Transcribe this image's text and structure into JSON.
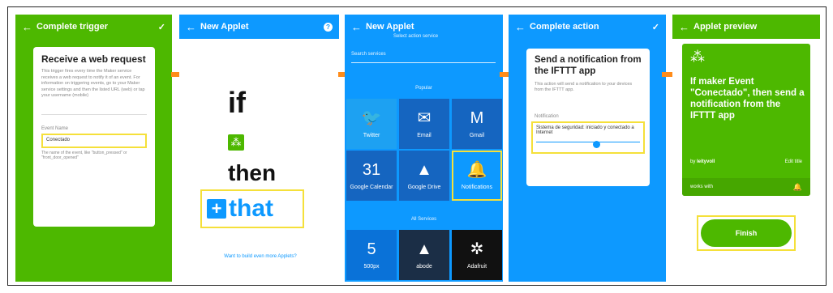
{
  "colors": {
    "green": "#4db800",
    "blue": "#0d99ff",
    "accent_arrow": "#ff8c1a",
    "highlight": "#f5e03a"
  },
  "panel1": {
    "title": "Complete trigger",
    "back_icon": "back-arrow-icon",
    "check_icon": "check-icon",
    "card_title": "Receive a web request",
    "card_desc": "This trigger fires every time the Maker service receives a web request to notify it of an event. For information on triggering events, go to your Maker service settings and then the listed URL (web) or tap your username (mobile)",
    "field_label": "Event Name",
    "field_value": "Conectado",
    "field_hint": "The name of the event, like \"button_pressed\" or \"front_door_opened\""
  },
  "panel2": {
    "title": "New Applet",
    "help_icon": "help-icon",
    "if_text": "if",
    "then_text": "then",
    "that_text": "that",
    "footer_link": "Want to build even more Applets?"
  },
  "panel3": {
    "title": "New Applet",
    "subtitle": "Select action service",
    "search_placeholder": "Search services",
    "section_popular": "Popular",
    "section_all": "All Services",
    "tiles_popular": [
      {
        "label": "Twitter",
        "icon": "twitter-icon",
        "glyph": "🐦",
        "color": "#1da1f2"
      },
      {
        "label": "Email",
        "icon": "email-icon",
        "glyph": "✉",
        "color": "#1565c0"
      },
      {
        "label": "Gmail",
        "icon": "gmail-icon",
        "glyph": "M",
        "color": "#1565c0"
      },
      {
        "label": "Google Calendar",
        "icon": "calendar-icon",
        "glyph": "31",
        "color": "#1565c0"
      },
      {
        "label": "Google Drive",
        "icon": "drive-icon",
        "glyph": "▲",
        "color": "#1565c0"
      },
      {
        "label": "Notifications",
        "icon": "bell-icon",
        "glyph": "🔔",
        "color": "#0d99ff"
      }
    ],
    "tiles_all": [
      {
        "label": "500px",
        "icon": "500px-icon",
        "glyph": "5",
        "color": "#0a72d8"
      },
      {
        "label": "abode",
        "icon": "abode-icon",
        "glyph": "▲",
        "color": "#1b2e46"
      },
      {
        "label": "Adafruit",
        "icon": "adafruit-icon",
        "glyph": "✲",
        "color": "#111111"
      }
    ]
  },
  "panel4": {
    "title": "Complete action",
    "card_title": "Send a notification from the IFTTT app",
    "card_desc": "This action will send a notification to your devices from the IFTTT app.",
    "field_label": "Notification",
    "field_value": "Sistema de seguridad: iniciado y conectado a Internet"
  },
  "panel5": {
    "title": "Applet preview",
    "summary": "If maker Event \"Conectado\", then send a notification from the IFTTT app",
    "author_prefix": "by",
    "author": "leityvoll",
    "edit_label": "Edit title",
    "works_with": "works with",
    "finish_label": "Finish"
  }
}
